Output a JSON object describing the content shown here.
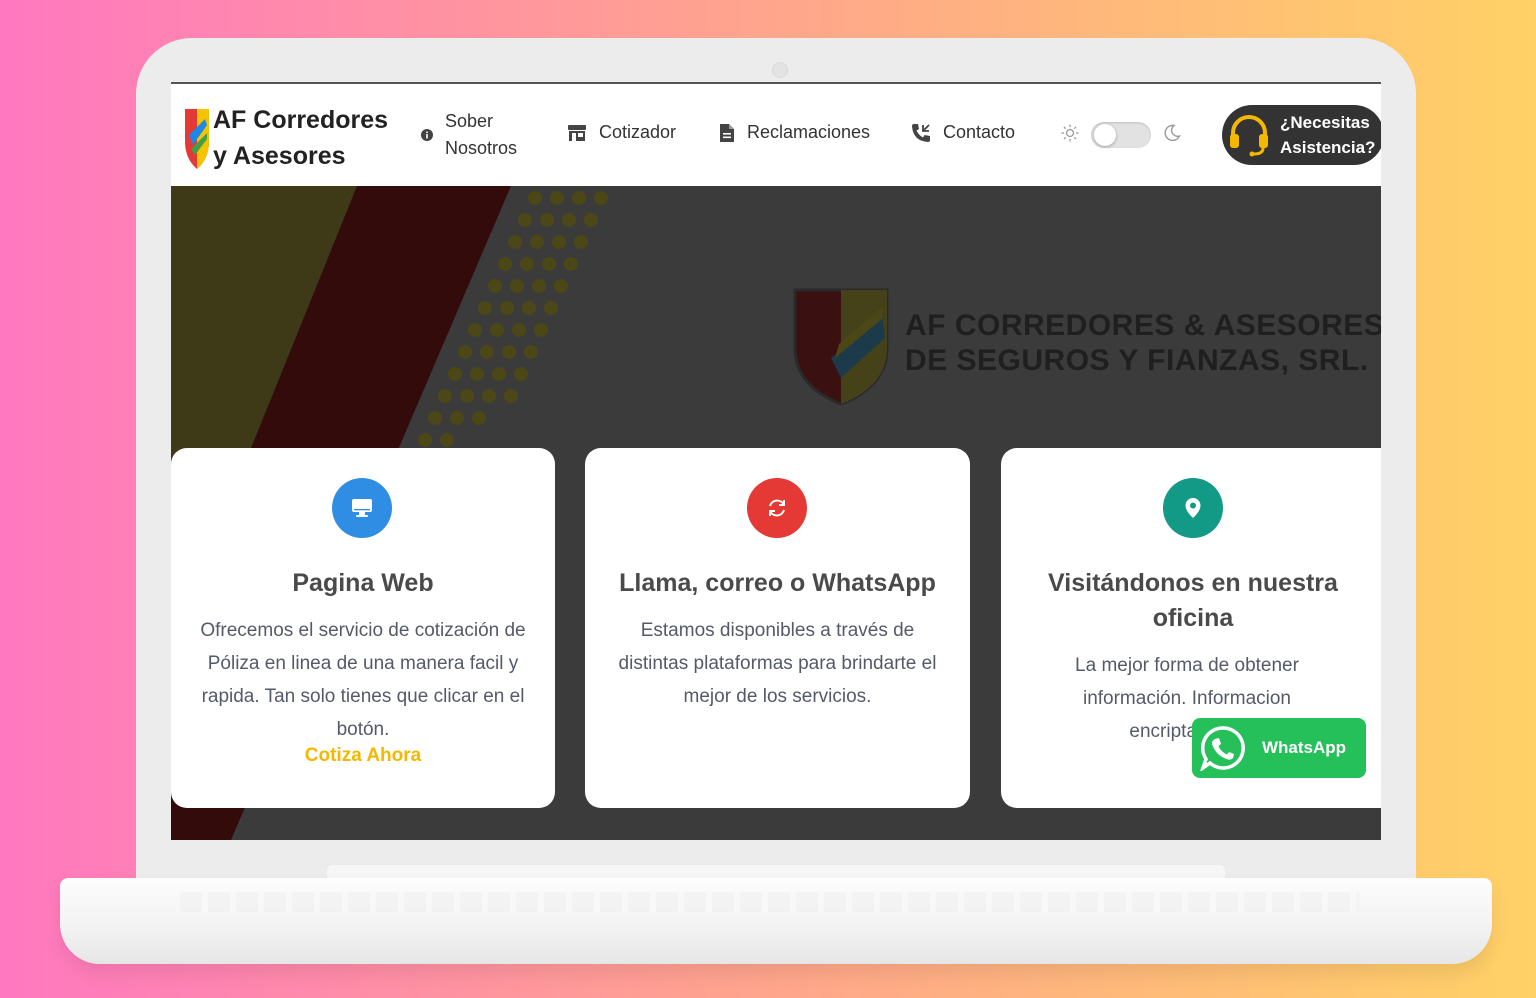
{
  "navbar": {
    "brand": "AF Corredores y Asesores",
    "items": [
      {
        "label": "Sober Nosotros",
        "icon": "info-icon"
      },
      {
        "label": "Cotizador",
        "icon": "store-icon"
      },
      {
        "label": "Reclamaciones",
        "icon": "file-icon"
      },
      {
        "label": "Contacto",
        "icon": "phone-call-icon"
      }
    ],
    "theme_toggle": {
      "light_icon": "sun-icon",
      "dark_icon": "moon-icon",
      "state": "light"
    },
    "assist_button": {
      "label": "¿Necesitas Asistencia?",
      "icon": "headset-icon"
    }
  },
  "hero": {
    "title_line1": "AF CORREDORES & ASESORES",
    "title_line2": "DE SEGUROS Y FIANZAS, SRL."
  },
  "cards": [
    {
      "icon": "monitor-icon",
      "icon_color": "#2f8ee4",
      "title": "Pagina Web",
      "text": "Ofrecemos el servicio de cotización de Póliza en linea de una manera facil y rapida. Tan solo tienes que clicar en el botón.",
      "link": "Cotiza Ahora"
    },
    {
      "icon": "refresh-icon",
      "icon_color": "#e53935",
      "title": "Llama, correo o WhatsApp",
      "text": "Estamos disponibles a través de distintas plataformas para brindarte el mejor de los servicios."
    },
    {
      "icon": "map-pin-icon",
      "icon_color": "#129a86",
      "title": "Visitándonos en nuestra oficina",
      "text": "La mejor forma de obtener información. Informacion encriptada de"
    }
  ],
  "whatsapp_button": {
    "label": "WhatsApp",
    "icon": "whatsapp-icon",
    "color": "#25c05a"
  },
  "colors": {
    "accent_link": "#f5b800",
    "dark_bg": "#3b3b3b"
  }
}
